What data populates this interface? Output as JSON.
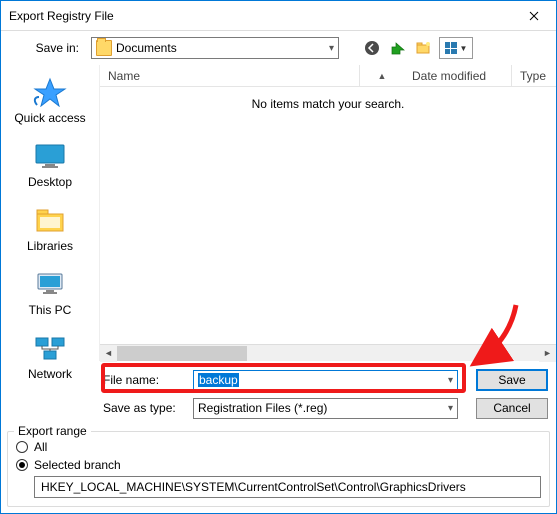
{
  "window": {
    "title": "Export Registry File"
  },
  "toolbar": {
    "save_in_label": "Save in:",
    "save_in_value": "Documents"
  },
  "places": [
    {
      "label": "Quick access"
    },
    {
      "label": "Desktop"
    },
    {
      "label": "Libraries"
    },
    {
      "label": "This PC"
    },
    {
      "label": "Network"
    }
  ],
  "columns": {
    "name": "Name",
    "date": "Date modified",
    "type": "Type"
  },
  "list_empty": "No items match your search.",
  "form": {
    "file_name_label": "File name:",
    "file_name_value": "backup",
    "save_as_type_label": "Save as type:",
    "save_as_type_value": "Registration Files (*.reg)",
    "save_button": "Save",
    "cancel_button": "Cancel"
  },
  "export_range": {
    "group_label": "Export range",
    "all_label": "All",
    "selected_label": "Selected branch",
    "selected_path": "HKEY_LOCAL_MACHINE\\SYSTEM\\CurrentControlSet\\Control\\GraphicsDrivers"
  }
}
